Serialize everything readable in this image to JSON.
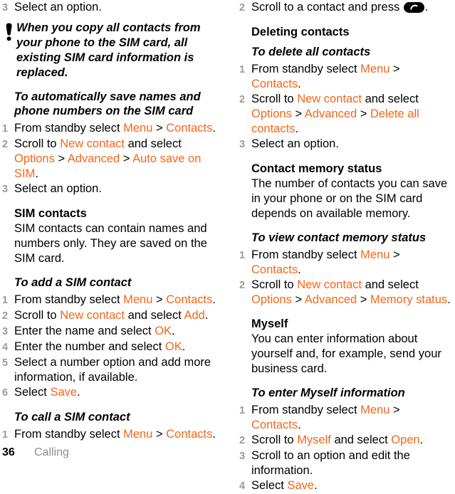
{
  "document": {
    "page_number": "36",
    "chapter": "Calling",
    "accent_color": "#F4661B",
    "number_color": "#9a9a9a",
    "footer_chapter_color": "#8c8c8c"
  },
  "left_column": {
    "step_3_top": {
      "number": "3",
      "text": "Select an option."
    },
    "note": {
      "icon": "exclamation-icon",
      "text": "When you copy all contacts from your phone to the SIM card, all existing SIM card information is replaced."
    },
    "heading_auto_save": "To automatically save names and phone numbers on the SIM card",
    "auto_save_steps": [
      {
        "number": "1",
        "parts": [
          {
            "t": "From standby select ",
            "c": "black"
          },
          {
            "t": "Menu",
            "c": "orange"
          },
          {
            "t": " > ",
            "c": "black"
          },
          {
            "t": "Contacts",
            "c": "orange"
          },
          {
            "t": ".",
            "c": "black"
          }
        ]
      },
      {
        "number": "2",
        "parts": [
          {
            "t": "Scroll to ",
            "c": "black"
          },
          {
            "t": "New contact",
            "c": "orange"
          },
          {
            "t": " and select ",
            "c": "black"
          },
          {
            "t": "Options",
            "c": "orange"
          },
          {
            "t": " > ",
            "c": "black"
          },
          {
            "t": "Advanced",
            "c": "orange"
          },
          {
            "t": " > ",
            "c": "black"
          },
          {
            "t": "Auto save on SIM",
            "c": "orange"
          },
          {
            "t": ".",
            "c": "black"
          }
        ]
      },
      {
        "number": "3",
        "parts": [
          {
            "t": "Select an option.",
            "c": "black"
          }
        ]
      }
    ],
    "heading_sim_contacts": "SIM contacts",
    "sim_contacts_body": "SIM contacts can contain names and numbers only. They are saved on the SIM card.",
    "heading_add_sim_contact": "To add a SIM contact",
    "add_sim_contact_steps": [
      {
        "number": "1",
        "parts": [
          {
            "t": "From standby select ",
            "c": "black"
          },
          {
            "t": "Menu",
            "c": "orange"
          },
          {
            "t": " > ",
            "c": "black"
          },
          {
            "t": "Contacts",
            "c": "orange"
          },
          {
            "t": ".",
            "c": "black"
          }
        ]
      },
      {
        "number": "2",
        "parts": [
          {
            "t": "Scroll to ",
            "c": "black"
          },
          {
            "t": "New contact",
            "c": "orange"
          },
          {
            "t": " and select ",
            "c": "black"
          },
          {
            "t": "Add",
            "c": "orange"
          },
          {
            "t": ".",
            "c": "black"
          }
        ]
      },
      {
        "number": "3",
        "parts": [
          {
            "t": "Enter the name and select ",
            "c": "black"
          },
          {
            "t": "OK",
            "c": "orange"
          },
          {
            "t": ".",
            "c": "black"
          }
        ]
      },
      {
        "number": "4",
        "parts": [
          {
            "t": "Enter the number and select ",
            "c": "black"
          },
          {
            "t": "OK",
            "c": "orange"
          },
          {
            "t": ".",
            "c": "black"
          }
        ]
      },
      {
        "number": "5",
        "parts": [
          {
            "t": "Select a number option and add more information, if available.",
            "c": "black"
          }
        ]
      },
      {
        "number": "6",
        "parts": [
          {
            "t": "Select ",
            "c": "black"
          },
          {
            "t": "Save",
            "c": "orange"
          },
          {
            "t": ".",
            "c": "black"
          }
        ]
      }
    ],
    "heading_call_sim_contact": "To call a SIM contact",
    "call_sim_contact_steps": [
      {
        "number": "1",
        "parts": [
          {
            "t": "From standby select ",
            "c": "black"
          },
          {
            "t": "Menu",
            "c": "orange"
          },
          {
            "t": " > ",
            "c": "black"
          },
          {
            "t": "Contacts",
            "c": "orange"
          },
          {
            "t": ".",
            "c": "black"
          }
        ]
      }
    ]
  },
  "right_column": {
    "call_step": {
      "number": "2",
      "text_before": "Scroll to a contact and press",
      "icon": "call-key-icon",
      "text_after": "."
    },
    "heading_deleting_contacts": "Deleting contacts",
    "heading_delete_all": "To delete all contacts",
    "delete_all_steps": [
      {
        "number": "1",
        "parts": [
          {
            "t": "From standby select ",
            "c": "black"
          },
          {
            "t": "Menu",
            "c": "orange"
          },
          {
            "t": " > ",
            "c": "black"
          },
          {
            "t": "Contacts",
            "c": "orange"
          },
          {
            "t": ".",
            "c": "black"
          }
        ]
      },
      {
        "number": "2",
        "parts": [
          {
            "t": "Scroll to ",
            "c": "black"
          },
          {
            "t": "New contact",
            "c": "orange"
          },
          {
            "t": " and select ",
            "c": "black"
          },
          {
            "t": "Options",
            "c": "orange"
          },
          {
            "t": " > ",
            "c": "black"
          },
          {
            "t": "Advanced",
            "c": "orange"
          },
          {
            "t": " > ",
            "c": "black"
          },
          {
            "t": "Delete all contacts",
            "c": "orange"
          },
          {
            "t": ".",
            "c": "black"
          }
        ]
      },
      {
        "number": "3",
        "parts": [
          {
            "t": "Select an option.",
            "c": "black"
          }
        ]
      }
    ],
    "heading_contact_memory_status": "Contact memory status",
    "contact_memory_body": "The number of contacts you can save in your phone or on the SIM card depends on available memory.",
    "heading_view_memory_status": "To view contact memory status",
    "view_memory_steps": [
      {
        "number": "1",
        "parts": [
          {
            "t": "From standby select ",
            "c": "black"
          },
          {
            "t": "Menu",
            "c": "orange"
          },
          {
            "t": " > ",
            "c": "black"
          },
          {
            "t": "Contacts",
            "c": "orange"
          },
          {
            "t": ".",
            "c": "black"
          }
        ]
      },
      {
        "number": "2",
        "parts": [
          {
            "t": "Scroll to ",
            "c": "black"
          },
          {
            "t": "New contact",
            "c": "orange"
          },
          {
            "t": " and select ",
            "c": "black"
          },
          {
            "t": "Options",
            "c": "orange"
          },
          {
            "t": " > ",
            "c": "black"
          },
          {
            "t": "Advanced",
            "c": "orange"
          },
          {
            "t": " > ",
            "c": "black"
          },
          {
            "t": "Memory status",
            "c": "orange"
          },
          {
            "t": ".",
            "c": "black"
          }
        ]
      }
    ],
    "heading_myself": "Myself",
    "myself_body": "You can enter information about yourself and, for example, send your business card.",
    "heading_enter_myself": "To enter Myself information",
    "enter_myself_steps": [
      {
        "number": "1",
        "parts": [
          {
            "t": "From standby select ",
            "c": "black"
          },
          {
            "t": "Menu",
            "c": "orange"
          },
          {
            "t": " > ",
            "c": "black"
          },
          {
            "t": "Contacts",
            "c": "orange"
          },
          {
            "t": ".",
            "c": "black"
          }
        ]
      },
      {
        "number": "2",
        "parts": [
          {
            "t": "Scroll to ",
            "c": "black"
          },
          {
            "t": "Myself",
            "c": "orange"
          },
          {
            "t": " and select ",
            "c": "black"
          },
          {
            "t": "Open",
            "c": "orange"
          },
          {
            "t": ".",
            "c": "black"
          }
        ]
      },
      {
        "number": "3",
        "parts": [
          {
            "t": "Scroll to an option and edit the information.",
            "c": "black"
          }
        ]
      },
      {
        "number": "4",
        "parts": [
          {
            "t": "Select ",
            "c": "black"
          },
          {
            "t": "Save",
            "c": "orange"
          },
          {
            "t": ".",
            "c": "black"
          }
        ]
      }
    ]
  }
}
